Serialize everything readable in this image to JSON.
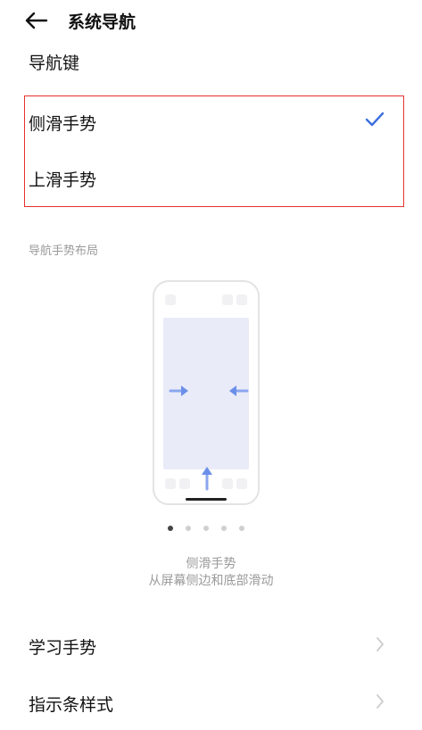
{
  "header": {
    "title": "系统导航",
    "back_icon": "arrow-left-icon"
  },
  "nav_key": {
    "label": "导航键"
  },
  "options": [
    {
      "label": "侧滑手势",
      "selected": true
    },
    {
      "label": "上滑手势",
      "selected": false
    }
  ],
  "layout_section": {
    "label": "导航手势布局"
  },
  "preview": {
    "page_indicator": {
      "count": 5,
      "active_index": 0
    },
    "caption_title": "侧滑手势",
    "caption_desc": "从屏幕侧边和底部滑动"
  },
  "list": [
    {
      "label": "学习手势",
      "icon": "chevron-right-icon"
    },
    {
      "label": "指示条样式",
      "icon": "chevron-right-icon"
    }
  ],
  "colors": {
    "accent": "#3d6fe0",
    "highlight_border": "#e5322d",
    "muted_text": "#9a9a9a"
  }
}
